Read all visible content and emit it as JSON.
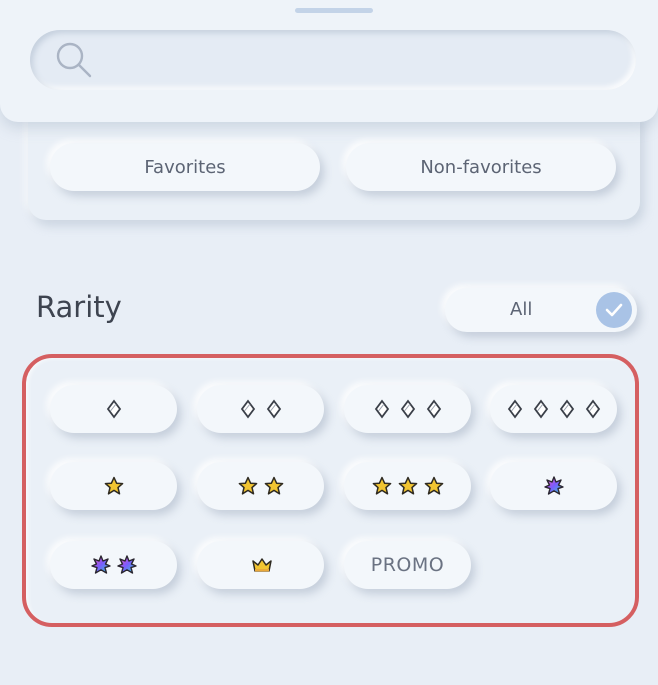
{
  "search": {
    "placeholder": "",
    "value": ""
  },
  "filters": {
    "favorites_label": "Favorites",
    "non_favorites_label": "Non-favorites"
  },
  "rarity": {
    "title": "Rarity",
    "all_label": "All",
    "all_checked": true,
    "options": [
      {
        "icon": "diamond-icon",
        "count": 1
      },
      {
        "icon": "diamond-icon",
        "count": 2
      },
      {
        "icon": "diamond-icon",
        "count": 3
      },
      {
        "icon": "diamond-icon",
        "count": 4
      },
      {
        "icon": "star-icon",
        "count": 1
      },
      {
        "icon": "star-icon",
        "count": 2
      },
      {
        "icon": "star-icon",
        "count": 3
      },
      {
        "icon": "shiny-star-icon",
        "count": 1
      },
      {
        "icon": "shiny-star-icon",
        "count": 2
      },
      {
        "icon": "crown-icon",
        "count": 1
      },
      {
        "label": "PROMO"
      }
    ]
  },
  "colors": {
    "accent": "#a9c3e6",
    "highlight_border": "#d55f61",
    "star_fill": "#f2c531"
  }
}
